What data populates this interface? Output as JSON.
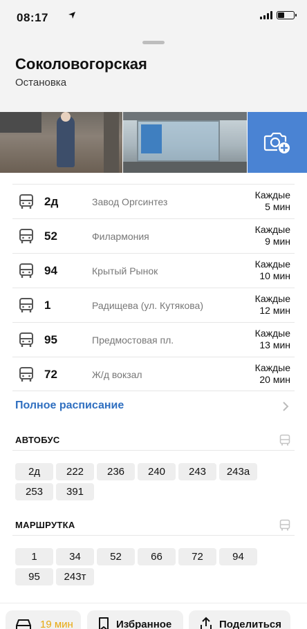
{
  "status_bar": {
    "time": "08:17"
  },
  "stop": {
    "title": "Соколовогорская",
    "subtitle": "Остановка"
  },
  "routes": [
    {
      "number": "2д",
      "destination": "Завод Оргсинтез",
      "freq_line1": "Каждые",
      "freq_line2": "5 мин"
    },
    {
      "number": "52",
      "destination": "Филармония",
      "freq_line1": "Каждые",
      "freq_line2": "9 мин"
    },
    {
      "number": "94",
      "destination": "Крытый Рынок",
      "freq_line1": "Каждые",
      "freq_line2": "10 мин"
    },
    {
      "number": "1",
      "destination": "Радищева (ул. Кутякова)",
      "freq_line1": "Каждые",
      "freq_line2": "12 мин"
    },
    {
      "number": "95",
      "destination": "Предмостовая пл.",
      "freq_line1": "Каждые",
      "freq_line2": "13 мин"
    },
    {
      "number": "72",
      "destination": "Ж/д вокзал",
      "freq_line1": "Каждые",
      "freq_line2": "20 мин"
    }
  ],
  "full_schedule_label": "Полное расписание",
  "bus_section": {
    "title": "АВТОБУС",
    "routes": [
      "2д",
      "222",
      "236",
      "240",
      "243",
      "243а",
      "253",
      "391"
    ]
  },
  "minibus_section": {
    "title": "МАРШРУТКА",
    "routes": [
      "1",
      "34",
      "52",
      "66",
      "72",
      "94",
      "95",
      "243т"
    ]
  },
  "bottom_bar": {
    "eta": "19 мин",
    "favorites": "Избранное",
    "share": "Поделиться"
  },
  "colors": {
    "accent": "#2f6fc0",
    "photo_add_bg": "#4a83d3",
    "eta": "#e7a80f"
  }
}
